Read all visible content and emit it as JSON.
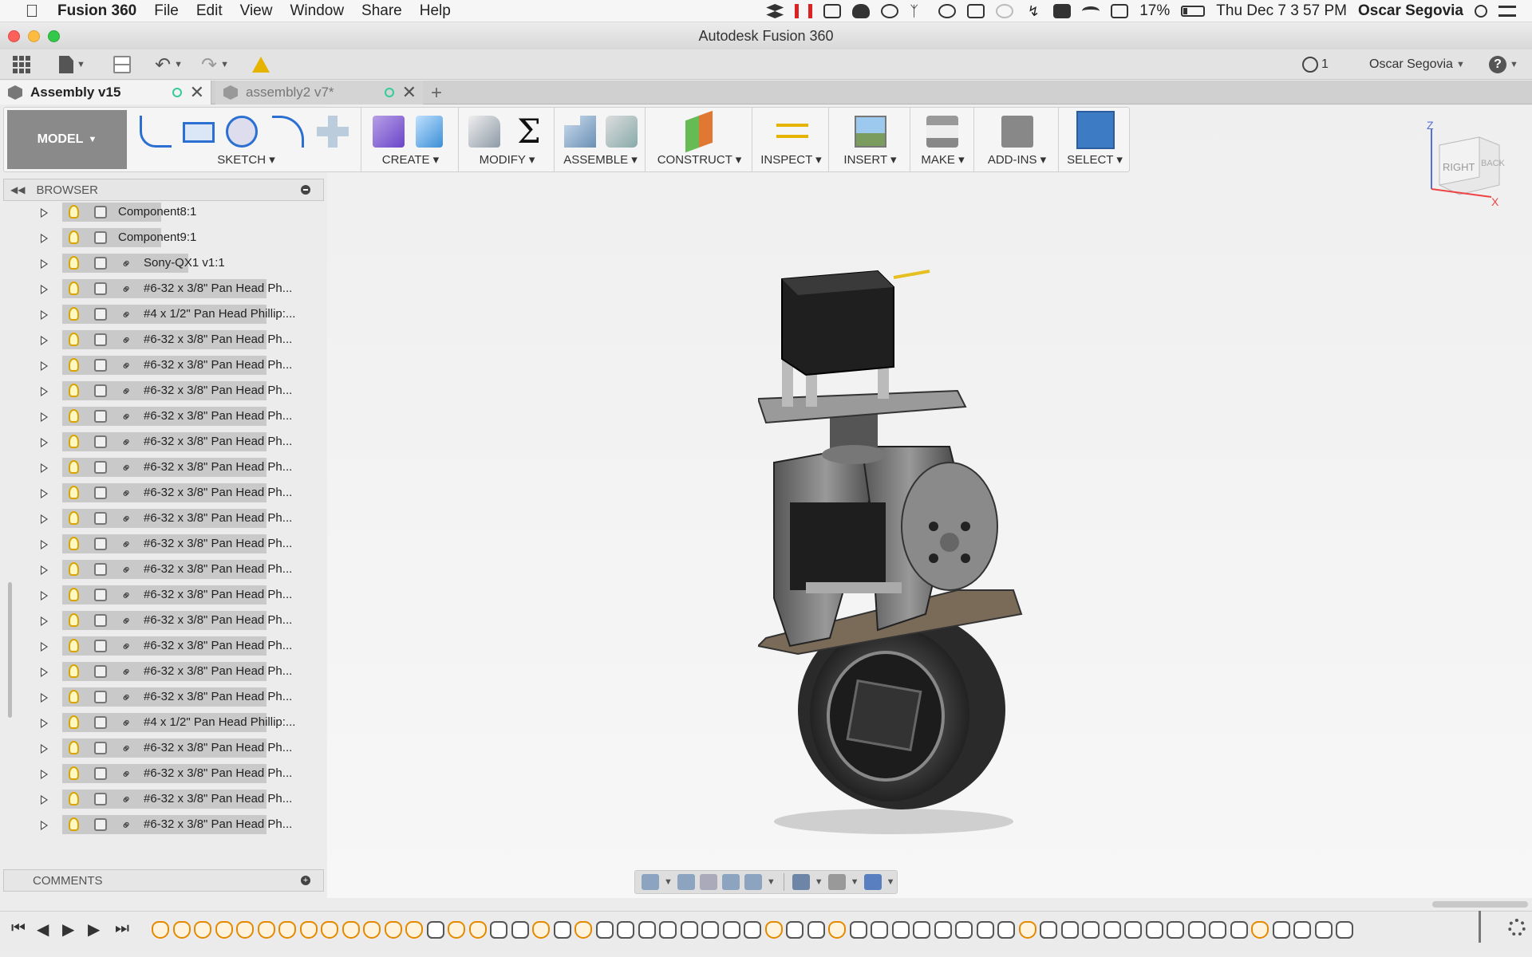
{
  "menubar": {
    "app_name": "Fusion 360",
    "menus": [
      "File",
      "Edit",
      "View",
      "Window",
      "Share",
      "Help"
    ],
    "battery": "17%",
    "datetime": "Thu Dec 7  3 57 PM",
    "user": "Oscar Segovia",
    "status_icons": [
      "dropbox-icon",
      "pause-icon",
      "screenshot-icon",
      "cloud-upload-icon",
      "creative-cloud-icon",
      "fork-icon",
      "timer-icon",
      "grid-icon",
      "time-machine-icon",
      "bluetooth-icon",
      "battery-status-icon",
      "wifi-icon",
      "airplay-icon"
    ]
  },
  "window": {
    "title": "Autodesk Fusion 360"
  },
  "quick_access": {
    "job_status_count": "1",
    "user": "Oscar Segovia",
    "help_symbol": "?"
  },
  "tabs": [
    {
      "label": "Assembly v15",
      "active": true
    },
    {
      "label": "assembly2 v7*",
      "active": false
    }
  ],
  "ribbon": {
    "workspace": "MODEL",
    "groups": [
      "SKETCH",
      "CREATE",
      "MODIFY",
      "ASSEMBLE",
      "CONSTRUCT",
      "INSPECT",
      "INSERT",
      "MAKE",
      "ADD-INS",
      "SELECT"
    ]
  },
  "browser": {
    "title": "BROWSER",
    "items": [
      {
        "label": "Component8:1",
        "linked": false
      },
      {
        "label": "Component9:1",
        "linked": false
      },
      {
        "label": "Sony-QX1 v1:1",
        "linked": true
      },
      {
        "label": "#6-32 x 3/8\" Pan Head Ph...",
        "linked": true
      },
      {
        "label": "#4 x 1/2\" Pan Head Phillip:...",
        "linked": true
      },
      {
        "label": "#6-32 x 3/8\" Pan Head Ph...",
        "linked": true
      },
      {
        "label": "#6-32 x 3/8\" Pan Head Ph...",
        "linked": true
      },
      {
        "label": "#6-32 x 3/8\" Pan Head Ph...",
        "linked": true
      },
      {
        "label": "#6-32 x 3/8\" Pan Head Ph...",
        "linked": true
      },
      {
        "label": "#6-32 x 3/8\" Pan Head Ph...",
        "linked": true
      },
      {
        "label": "#6-32 x 3/8\" Pan Head Ph...",
        "linked": true
      },
      {
        "label": "#6-32 x 3/8\" Pan Head Ph...",
        "linked": true
      },
      {
        "label": "#6-32 x 3/8\" Pan Head Ph...",
        "linked": true
      },
      {
        "label": "#6-32 x 3/8\" Pan Head Ph...",
        "linked": true
      },
      {
        "label": "#6-32 x 3/8\" Pan Head Ph...",
        "linked": true
      },
      {
        "label": "#6-32 x 3/8\" Pan Head Ph...",
        "linked": true
      },
      {
        "label": "#6-32 x 3/8\" Pan Head Ph...",
        "linked": true
      },
      {
        "label": "#6-32 x 3/8\" Pan Head Ph...",
        "linked": true
      },
      {
        "label": "#6-32 x 3/8\" Pan Head Ph...",
        "linked": true
      },
      {
        "label": "#6-32 x 3/8\" Pan Head Ph...",
        "linked": true
      },
      {
        "label": "#4 x 1/2\" Pan Head Phillip:...",
        "linked": true
      },
      {
        "label": "#6-32 x 3/8\" Pan Head Ph...",
        "linked": true
      },
      {
        "label": "#6-32 x 3/8\" Pan Head Ph...",
        "linked": true
      },
      {
        "label": "#6-32 x 3/8\" Pan Head Ph...",
        "linked": true
      },
      {
        "label": "#6-32 x 3/8\" Pan Head Ph...",
        "linked": true
      }
    ]
  },
  "comments": {
    "title": "COMMENTS"
  },
  "viewcube": {
    "faces": [
      "RIGHT",
      "BACK"
    ],
    "axes": [
      "Z",
      "X"
    ]
  },
  "timeline": {
    "items": [
      "joint",
      "joint",
      "joint",
      "joint",
      "joint",
      "joint",
      "joint",
      "joint",
      "joint",
      "joint",
      "joint",
      "joint",
      "joint",
      "link",
      "joint",
      "joint",
      "link",
      "link",
      "joint",
      "link",
      "joint",
      "link",
      "link",
      "link",
      "link",
      "link",
      "link",
      "link",
      "link",
      "joint",
      "link",
      "link",
      "joint",
      "link",
      "link",
      "link",
      "link",
      "link",
      "link",
      "link",
      "link",
      "joint",
      "link",
      "link",
      "link",
      "link",
      "link",
      "link",
      "link",
      "link",
      "link",
      "link",
      "joint",
      "link",
      "link",
      "link",
      "link"
    ]
  }
}
